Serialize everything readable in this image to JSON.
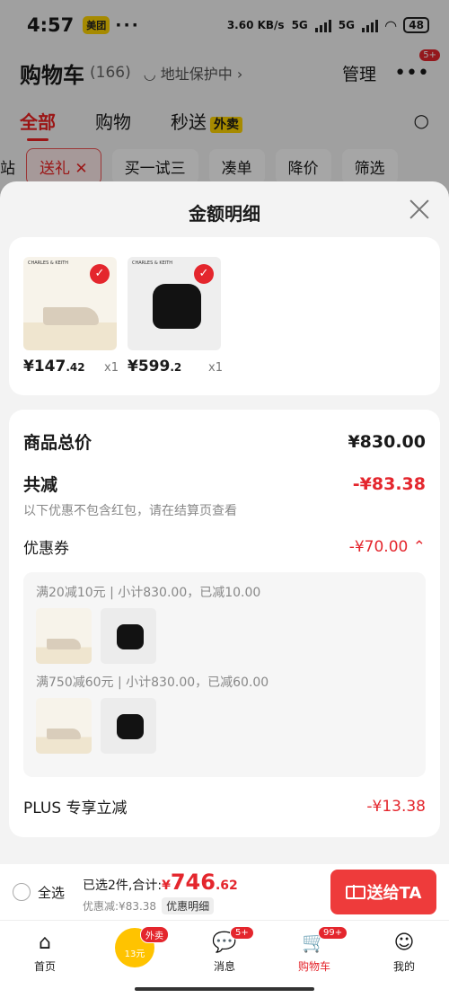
{
  "status": {
    "time": "4:57",
    "app_badge": "美团",
    "dots": "···",
    "net_speed": "3.60 KB/s",
    "net1": "5G",
    "net2": "5G",
    "battery": "48"
  },
  "header": {
    "title": "购物车",
    "count": "(166)",
    "address": "地址保护中",
    "manage": "管理",
    "badge": "5+"
  },
  "tabs": [
    {
      "label": "全部"
    },
    {
      "label": "购物"
    },
    {
      "label": "秒送",
      "tag": "外卖"
    }
  ],
  "filters": [
    "站",
    "送礼 ✕",
    "买一试三",
    "凑单",
    "降价",
    "筛选"
  ],
  "sheet": {
    "title": "金额明细",
    "products": [
      {
        "brand": "CHARLES & KEITH",
        "price_int": "¥147",
        "price_dec": ".42",
        "qty": "x1"
      },
      {
        "brand": "CHARLES & KEITH",
        "price_int": "¥599",
        "price_dec": ".2",
        "qty": "x1"
      }
    ],
    "total_label": "商品总价",
    "total_value": "¥830.00",
    "reduce_label": "共减",
    "reduce_value": "-¥83.38",
    "reduce_note": "以下优惠不包含红包，请在结算页查看",
    "coupon_label": "优惠券",
    "coupon_value": "-¥70.00",
    "coupon_rules": [
      "满20减10元 | 小计830.00，已减10.00",
      "满750减60元 | 小计830.00，已减60.00"
    ],
    "plus_label": "PLUS 专享立减",
    "plus_value": "-¥13.38"
  },
  "checkout": {
    "select_all": "全选",
    "selected": "已选2件,合计:",
    "currency": "¥",
    "amount_int": "746",
    "amount_dec": ".62",
    "saved": "优惠减:¥83.38",
    "detail_chip": "优惠明细",
    "send_label": "送给TA"
  },
  "nav": [
    {
      "label": "首页",
      "glyph": "⌂"
    },
    {
      "label": "",
      "badge": "外卖",
      "center": "13元"
    },
    {
      "label": "消息",
      "glyph": "💬",
      "badge": "5+"
    },
    {
      "label": "购物车",
      "glyph": "🛒",
      "badge": "99+"
    },
    {
      "label": "我的",
      "glyph": "☺"
    }
  ],
  "colors": {
    "accent": "#e4262d",
    "yellow": "#ffd400"
  }
}
